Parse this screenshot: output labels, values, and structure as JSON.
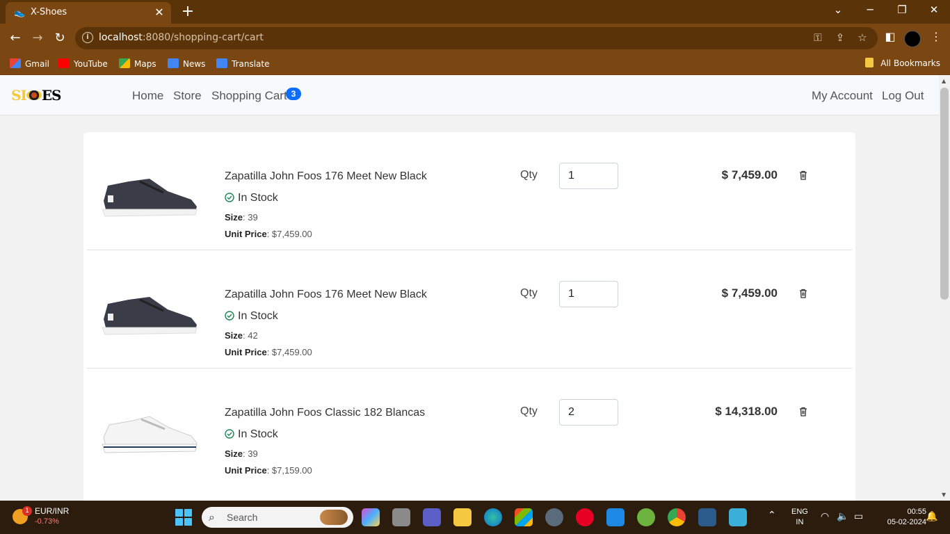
{
  "browser": {
    "tab_title": "X-Shoes",
    "tab_close": "✕",
    "new_tab": "+",
    "url_host": "localhost",
    "url_rest": ":8080/shopping-cart/cart",
    "bookmarks": [
      "Gmail",
      "YouTube",
      "Maps",
      "News",
      "Translate"
    ],
    "all_bookmarks": "All Bookmarks"
  },
  "nav": {
    "logo_left": "SI",
    "logo_right": "ES",
    "home": "Home",
    "store": "Store",
    "cart": "Shopping Cart",
    "cart_count": "3",
    "account": "My Account",
    "logout": "Log Out"
  },
  "cart": {
    "qty_label": "Qty",
    "items": [
      {
        "name": "Zapatilla John Foos 176 Meet New Black",
        "stock": "In Stock",
        "size_label": "Size",
        "size": ": 39",
        "unit_label": "Unit Price",
        "unit_price": ": $7,459.00",
        "qty": "1",
        "total": "$ 7,459.00",
        "color": "#3a3d47"
      },
      {
        "name": "Zapatilla John Foos 176 Meet New Black",
        "stock": "In Stock",
        "size_label": "Size",
        "size": ": 42",
        "unit_label": "Unit Price",
        "unit_price": ": $7,459.00",
        "qty": "1",
        "total": "$ 7,459.00",
        "color": "#3a3d47"
      },
      {
        "name": "Zapatilla John Foos Classic 182 Blancas",
        "stock": "In Stock",
        "size_label": "Size",
        "size": ": 39",
        "unit_label": "Unit Price",
        "unit_price": ": $7,159.00",
        "qty": "2",
        "total": "$ 14,318.00",
        "color": "#f4f4f4"
      }
    ]
  },
  "taskbar": {
    "weather_badge": "1",
    "ticker": "EUR/INR",
    "ticker_change": "-0.73%",
    "search_placeholder": "Search",
    "lang_top": "ENG",
    "lang_bottom": "IN",
    "time": "00:55",
    "date": "05-02-2024"
  },
  "colors": {
    "accent": "#0d6efd",
    "stock_green": "#198754",
    "browser_frame": "#7a4712"
  }
}
